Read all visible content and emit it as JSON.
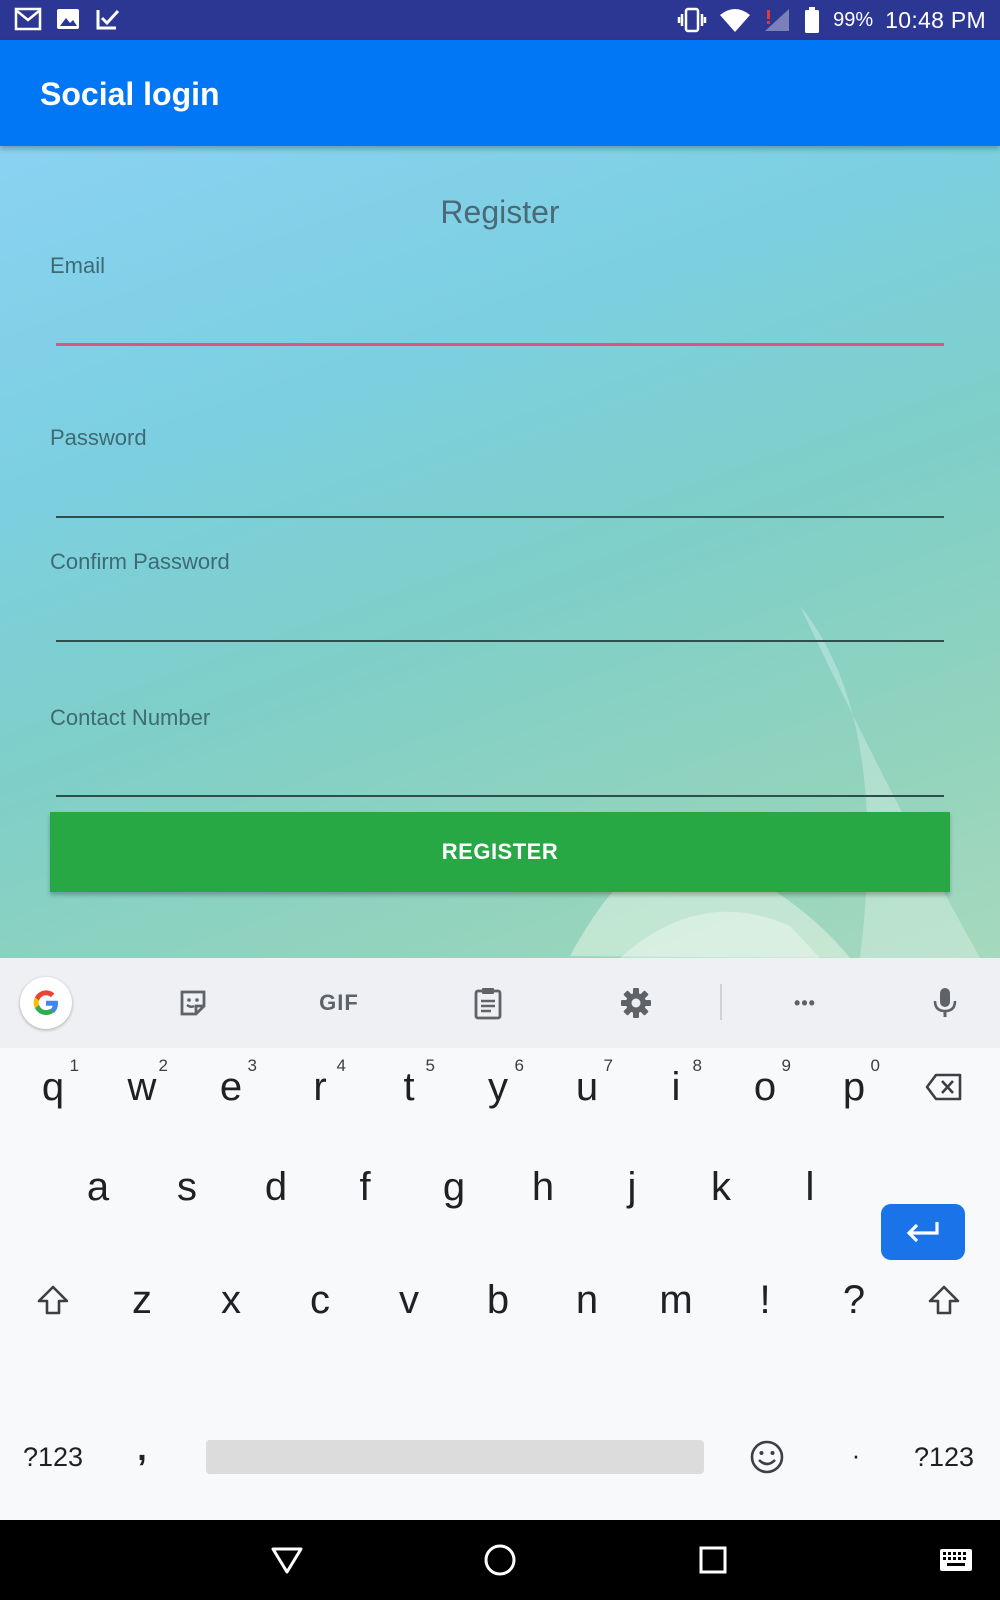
{
  "status_bar": {
    "battery": "99%",
    "time": "10:48 PM",
    "icons": [
      "gmail-icon",
      "gallery-icon",
      "tasks-icon",
      "vibrate-icon",
      "wifi-icon",
      "signal-icon",
      "battery-icon"
    ]
  },
  "app_bar": {
    "title": "Social login"
  },
  "form": {
    "title": "Register",
    "email_label": "Email",
    "email_value": "",
    "password_label": "Password",
    "confirm_password_label": "Confirm Password",
    "contact_label": "Contact Number",
    "register_button": "REGISTER",
    "focus_color": "#e2508a",
    "button_color": "#28a745"
  },
  "keyboard": {
    "toolbar": {
      "gif_label": "GIF",
      "more_label": "•••",
      "icons": [
        "google-icon",
        "sticker-icon",
        "gif-icon",
        "clipboard-icon",
        "settings-icon",
        "more-icon",
        "microphone-icon"
      ]
    },
    "row1": [
      {
        "key": "q",
        "hint": "1"
      },
      {
        "key": "w",
        "hint": "2"
      },
      {
        "key": "e",
        "hint": "3"
      },
      {
        "key": "r",
        "hint": "4"
      },
      {
        "key": "t",
        "hint": "5"
      },
      {
        "key": "y",
        "hint": "6"
      },
      {
        "key": "u",
        "hint": "7"
      },
      {
        "key": "i",
        "hint": "8"
      },
      {
        "key": "o",
        "hint": "9"
      },
      {
        "key": "p",
        "hint": "0"
      }
    ],
    "row2": [
      "a",
      "s",
      "d",
      "f",
      "g",
      "h",
      "j",
      "k",
      "l"
    ],
    "row3": [
      "z",
      "x",
      "c",
      "v",
      "b",
      "n",
      "m",
      "!",
      "?"
    ],
    "row4": {
      "sym_left": "?123",
      "comma": ",",
      "period": "·",
      "sym_right": "?123"
    },
    "accent_color": "#1a73e8"
  },
  "nav_bar": {
    "icons": [
      "back-icon",
      "home-icon",
      "recents-icon",
      "keyboard-switch-icon"
    ]
  }
}
